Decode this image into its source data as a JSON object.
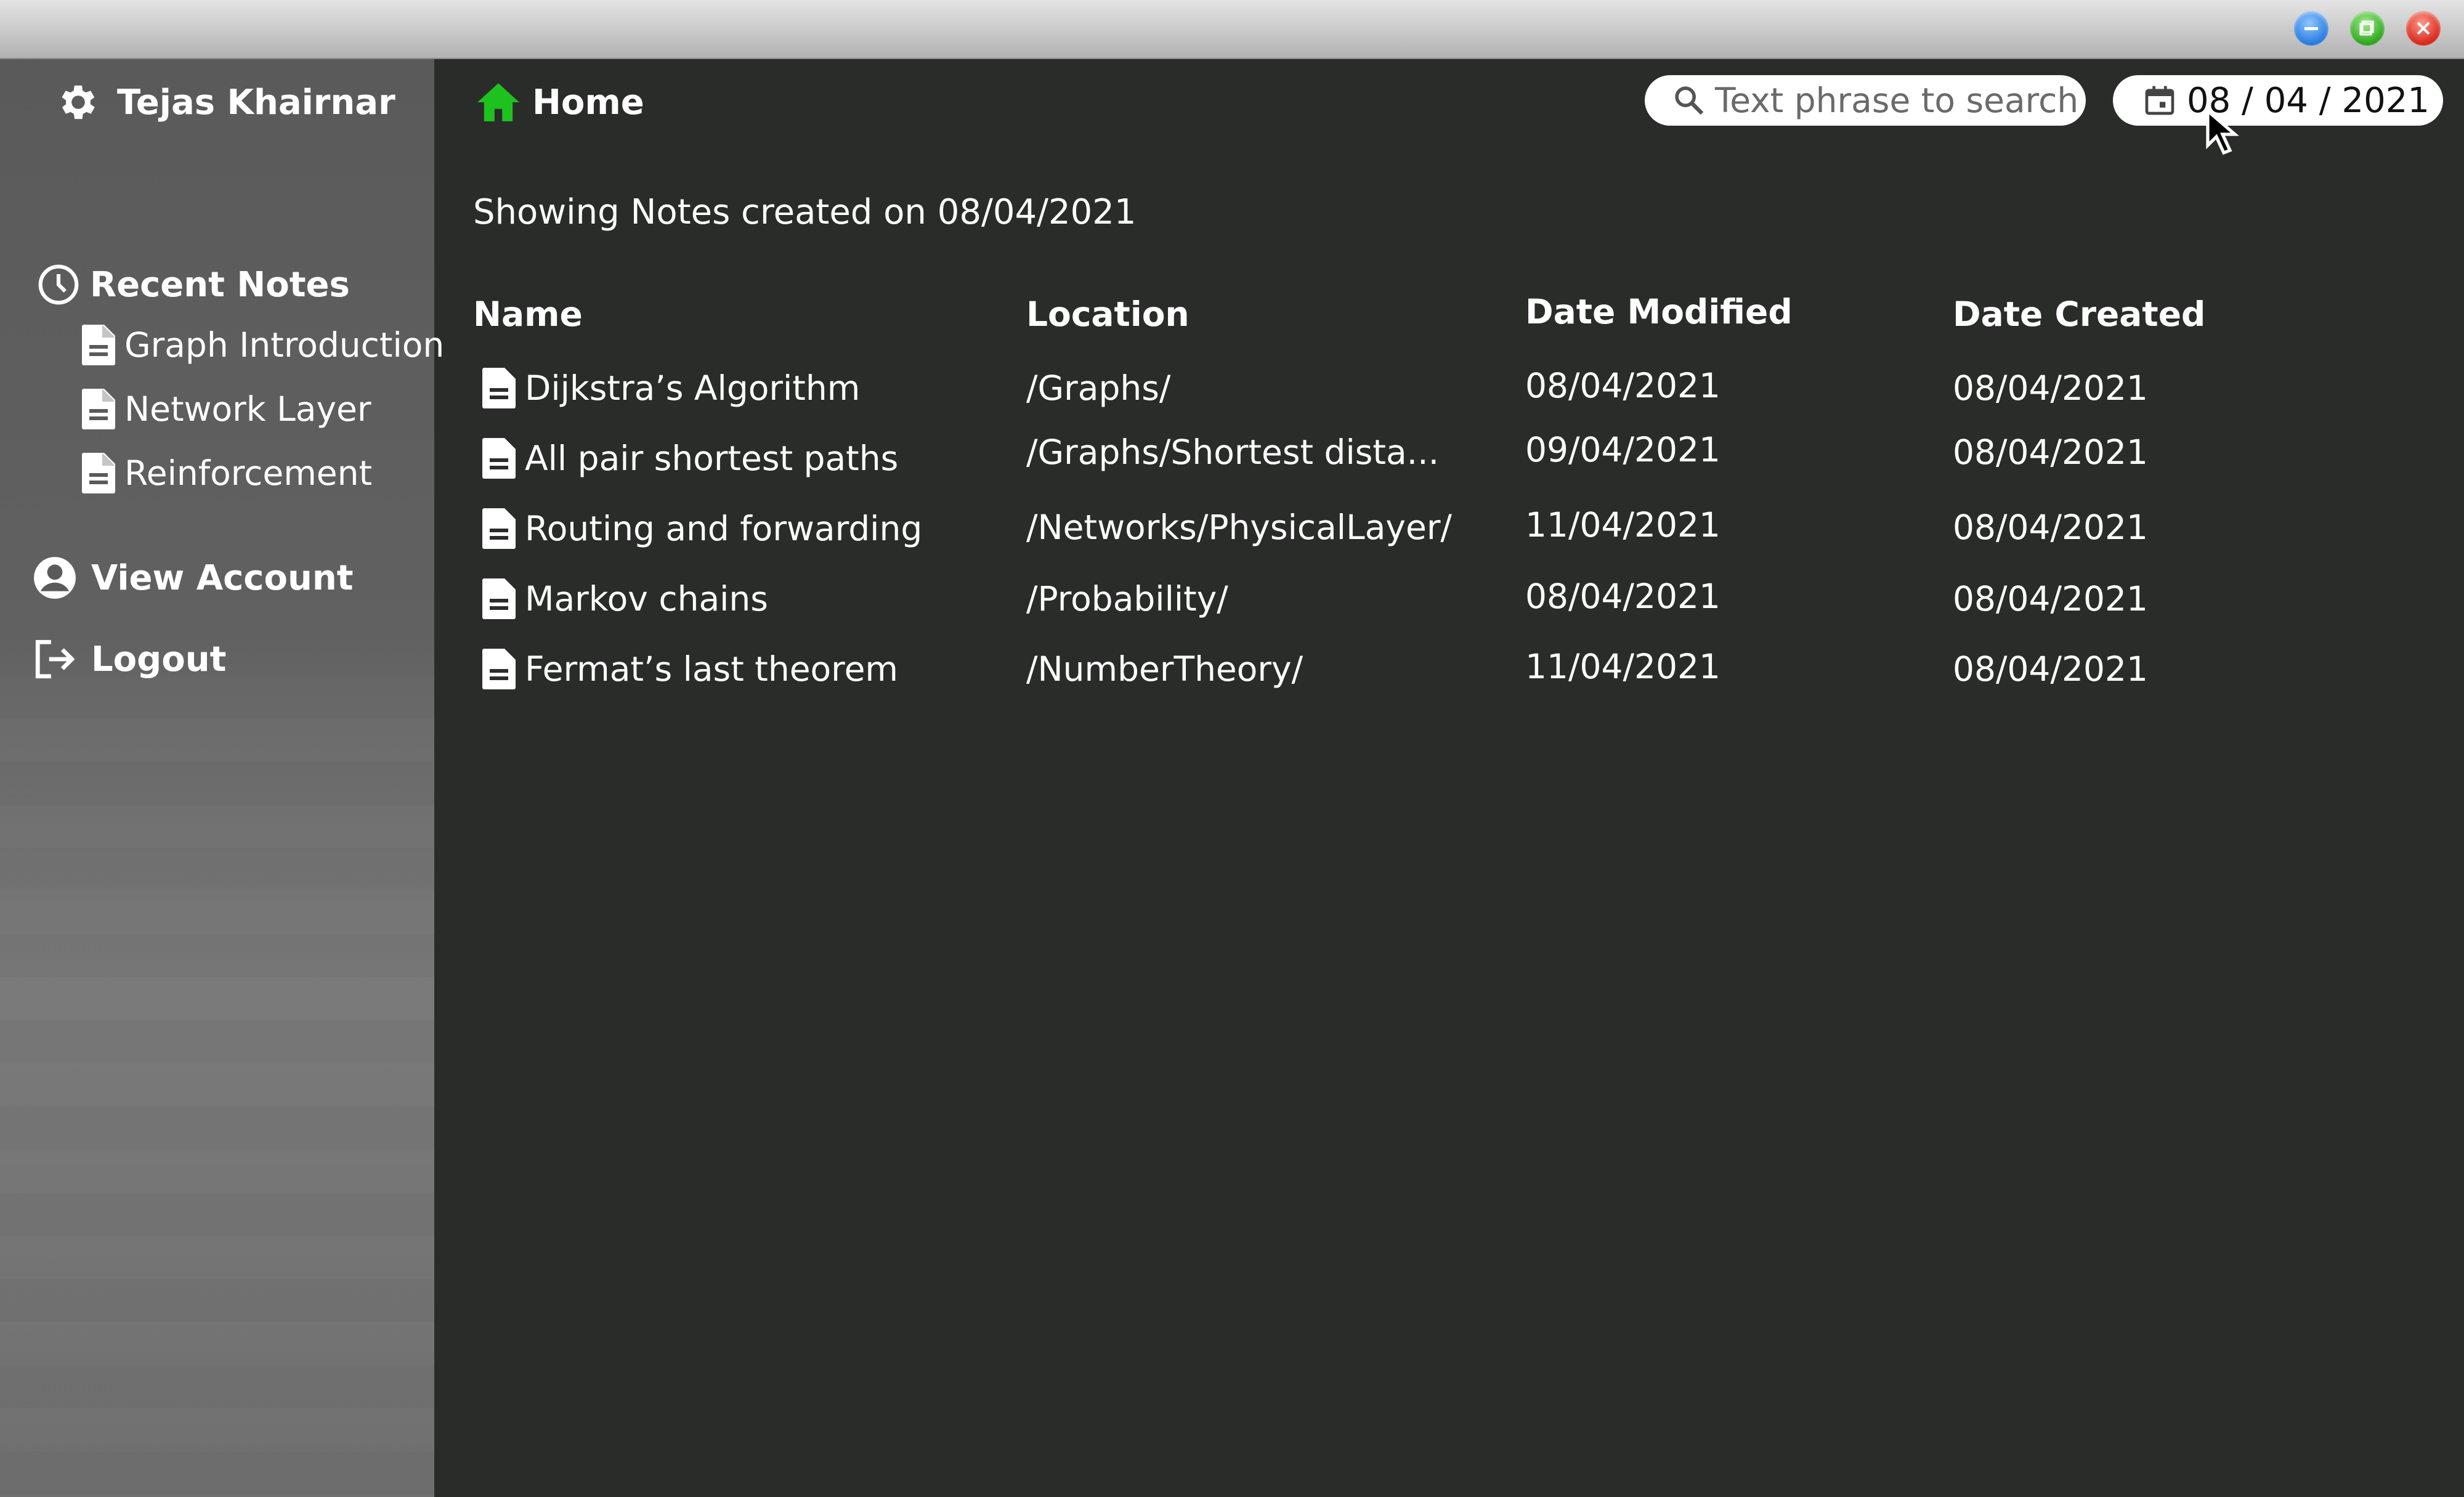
{
  "window": {
    "controls": [
      "minimize",
      "maximize",
      "close"
    ]
  },
  "sidebar": {
    "user_name": "Tejas Khairnar",
    "recent_heading": "Recent Notes",
    "recent_items": [
      "Graph Introduction",
      "Network Layer",
      "Reinforcement"
    ],
    "view_account": "View Account",
    "logout": "Logout"
  },
  "header": {
    "title": "Home",
    "search_placeholder": "Text phrase to search",
    "date_value": "08 / 04 / 2021"
  },
  "main": {
    "subtitle": "Showing Notes created on 08/04/2021",
    "columns": [
      "Name",
      "Location",
      "Date Modified",
      "Date Created"
    ],
    "rows": [
      {
        "name": "Dijkstra’s Algorithm",
        "location": "/Graphs/",
        "modified": "08/04/2021",
        "created": "08/04/2021"
      },
      {
        "name": "All pair shortest paths",
        "location": "/Graphs/Shortest dista...",
        "modified": "09/04/2021",
        "created": "08/04/2021"
      },
      {
        "name": "Routing and forwarding",
        "location": "/Networks/PhysicalLayer/",
        "modified": "11/04/2021",
        "created": "08/04/2021"
      },
      {
        "name": "Markov chains",
        "location": "/Probability/",
        "modified": "08/04/2021",
        "created": "08/04/2021"
      },
      {
        "name": "Fermat’s last theorem",
        "location": "/NumberTheory/",
        "modified": "11/04/2021",
        "created": "08/04/2021"
      }
    ]
  },
  "colors": {
    "main_bg": "#2a2c2a",
    "sidebar_bg": "#5a5a5a",
    "home_icon": "#1ec21e",
    "text": "#ffffff"
  },
  "icons": {
    "user": "gear-icon",
    "recent": "clock-icon",
    "note": "document-icon",
    "account": "account-circle-icon",
    "logout": "logout-icon",
    "home": "home-icon",
    "search": "search-icon",
    "date": "calendar-icon"
  }
}
